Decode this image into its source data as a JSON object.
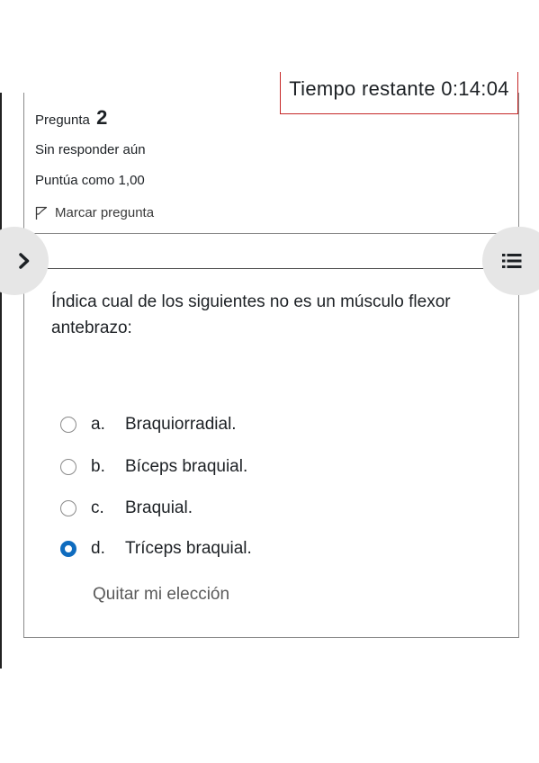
{
  "timer": {
    "label": "Tiempo restante 0:14:04"
  },
  "question_info": {
    "label": "Pregunta",
    "number": "2",
    "status": "Sin responder aún",
    "grade": "Puntúa como 1,00",
    "flag_label": "Marcar pregunta"
  },
  "question": {
    "text": "Índica cual de los siguientes no es un músculo flexor antebrazo:",
    "answers": [
      {
        "letter": "a.",
        "text": "Braquiorradial.",
        "checked": false
      },
      {
        "letter": "b.",
        "text": "Bíceps braquial.",
        "checked": false
      },
      {
        "letter": "c.",
        "text": "Braquial.",
        "checked": false
      },
      {
        "letter": "d.",
        "text": "Tríceps braquial.",
        "checked": true
      }
    ],
    "clear_label": "Quitar mi elección"
  },
  "drawers": {
    "left_icon": "chevron-right-icon",
    "right_icon": "list-icon"
  },
  "colors": {
    "timer_border": "#c62828",
    "radio_checked": "#0f6cbf",
    "drawer_bg": "#e6e6e6"
  }
}
